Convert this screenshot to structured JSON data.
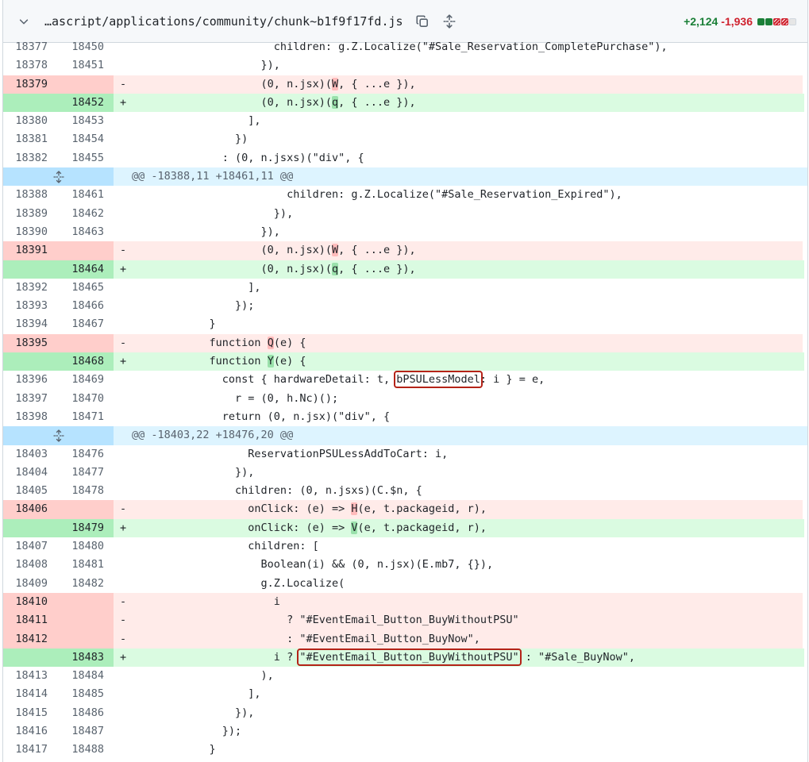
{
  "file": {
    "name": "…ascript/applications/community/chunk~b1f9f17fd.js",
    "additions": "+2,124",
    "deletions": "-1,936",
    "diffstat": [
      "g",
      "g",
      "r",
      "r",
      "n"
    ],
    "colors": {
      "add": "#1a7f37",
      "del": "#cf222e"
    }
  },
  "icons": {
    "collapse": "chevron-down-icon",
    "copy": "copy-icon",
    "expand_all": "unfold-icon",
    "expand_hunk": "unfold-icon"
  },
  "lines": [
    {
      "t": "ctx",
      "o": "18377",
      "n": "18450",
      "s": [
        {
          "x": "                      children: g.Z.Localize(\"#Sale_Reservation_CompletePurchase\"),"
        }
      ]
    },
    {
      "t": "ctx",
      "o": "18378",
      "n": "18451",
      "s": [
        {
          "x": "                    }),"
        }
      ]
    },
    {
      "t": "del",
      "o": "18379",
      "n": "",
      "s": [
        {
          "x": "                    (0, n.jsx)("
        },
        {
          "x": "W",
          "h": 1
        },
        {
          "x": ", { ...e }),"
        }
      ]
    },
    {
      "t": "add",
      "o": "",
      "n": "18452",
      "s": [
        {
          "x": "                    (0, n.jsx)("
        },
        {
          "x": "q",
          "h": 1
        },
        {
          "x": ", { ...e }),"
        }
      ]
    },
    {
      "t": "ctx",
      "o": "18380",
      "n": "18453",
      "s": [
        {
          "x": "                  ],"
        }
      ]
    },
    {
      "t": "ctx",
      "o": "18381",
      "n": "18454",
      "s": [
        {
          "x": "                })"
        }
      ]
    },
    {
      "t": "ctx",
      "o": "18382",
      "n": "18455",
      "s": [
        {
          "x": "              : (0, n.jsxs)(\"div\", {"
        }
      ]
    },
    {
      "t": "hunk",
      "s": [
        {
          "x": "@@ -18388,11 +18461,11 @@"
        }
      ]
    },
    {
      "t": "ctx",
      "o": "18388",
      "n": "18461",
      "s": [
        {
          "x": "                        children: g.Z.Localize(\"#Sale_Reservation_Expired\"),"
        }
      ]
    },
    {
      "t": "ctx",
      "o": "18389",
      "n": "18462",
      "s": [
        {
          "x": "                      }),"
        }
      ]
    },
    {
      "t": "ctx",
      "o": "18390",
      "n": "18463",
      "s": [
        {
          "x": "                    }),"
        }
      ]
    },
    {
      "t": "del",
      "o": "18391",
      "n": "",
      "s": [
        {
          "x": "                    (0, n.jsx)("
        },
        {
          "x": "W",
          "h": 1
        },
        {
          "x": ", { ...e }),"
        }
      ]
    },
    {
      "t": "add",
      "o": "",
      "n": "18464",
      "s": [
        {
          "x": "                    (0, n.jsx)("
        },
        {
          "x": "q",
          "h": 1
        },
        {
          "x": ", { ...e }),"
        }
      ]
    },
    {
      "t": "ctx",
      "o": "18392",
      "n": "18465",
      "s": [
        {
          "x": "                  ],"
        }
      ]
    },
    {
      "t": "ctx",
      "o": "18393",
      "n": "18466",
      "s": [
        {
          "x": "                });"
        }
      ]
    },
    {
      "t": "ctx",
      "o": "18394",
      "n": "18467",
      "s": [
        {
          "x": "            }"
        }
      ]
    },
    {
      "t": "del",
      "o": "18395",
      "n": "",
      "s": [
        {
          "x": "            function "
        },
        {
          "x": "Q",
          "h": 1
        },
        {
          "x": "(e) {"
        }
      ]
    },
    {
      "t": "add",
      "o": "",
      "n": "18468",
      "s": [
        {
          "x": "            function "
        },
        {
          "x": "Y",
          "h": 1
        },
        {
          "x": "(e) {"
        }
      ]
    },
    {
      "t": "ctx",
      "o": "18396",
      "n": "18469",
      "s": [
        {
          "x": "              const { hardwareDetail: t, "
        },
        {
          "x": "bPSULessModel",
          "b": 1
        },
        {
          "x": ": i } = e,"
        }
      ]
    },
    {
      "t": "ctx",
      "o": "18397",
      "n": "18470",
      "s": [
        {
          "x": "                r = (0, h.Nc)();"
        }
      ]
    },
    {
      "t": "ctx",
      "o": "18398",
      "n": "18471",
      "s": [
        {
          "x": "              return (0, n.jsx)(\"div\", {"
        }
      ]
    },
    {
      "t": "hunk",
      "s": [
        {
          "x": "@@ -18403,22 +18476,20 @@"
        }
      ]
    },
    {
      "t": "ctx",
      "o": "18403",
      "n": "18476",
      "s": [
        {
          "x": "                  ReservationPSULessAddToCart: i,"
        }
      ]
    },
    {
      "t": "ctx",
      "o": "18404",
      "n": "18477",
      "s": [
        {
          "x": "                }),"
        }
      ]
    },
    {
      "t": "ctx",
      "o": "18405",
      "n": "18478",
      "s": [
        {
          "x": "                children: (0, n.jsxs)(C.$n, {"
        }
      ]
    },
    {
      "t": "del",
      "o": "18406",
      "n": "",
      "s": [
        {
          "x": "                  onClick: (e) => "
        },
        {
          "x": "H",
          "h": 1
        },
        {
          "x": "(e, t.packageid, r),"
        }
      ]
    },
    {
      "t": "add",
      "o": "",
      "n": "18479",
      "s": [
        {
          "x": "                  onClick: (e) => "
        },
        {
          "x": "V",
          "h": 1
        },
        {
          "x": "(e, t.packageid, r),"
        }
      ]
    },
    {
      "t": "ctx",
      "o": "18407",
      "n": "18480",
      "s": [
        {
          "x": "                  children: ["
        }
      ]
    },
    {
      "t": "ctx",
      "o": "18408",
      "n": "18481",
      "s": [
        {
          "x": "                    Boolean(i) && (0, n.jsx)(E.mb7, {}),"
        }
      ]
    },
    {
      "t": "ctx",
      "o": "18409",
      "n": "18482",
      "s": [
        {
          "x": "                    g.Z.Localize("
        }
      ]
    },
    {
      "t": "del",
      "o": "18410",
      "n": "",
      "s": [
        {
          "x": "                      i"
        }
      ]
    },
    {
      "t": "del",
      "o": "18411",
      "n": "",
      "s": [
        {
          "x": "                        ? \"#EventEmail_Button_BuyWithoutPSU\""
        }
      ]
    },
    {
      "t": "del",
      "o": "18412",
      "n": "",
      "s": [
        {
          "x": "                        : \"#EventEmail_Button_BuyNow\","
        }
      ]
    },
    {
      "t": "add",
      "o": "",
      "n": "18483",
      "s": [
        {
          "x": "                      i ? "
        },
        {
          "x": "\"#EventEmail_Button_BuyWithoutPSU\"",
          "b": 1
        },
        {
          "x": " : \"#Sale_BuyNow\","
        }
      ]
    },
    {
      "t": "ctx",
      "o": "18413",
      "n": "18484",
      "s": [
        {
          "x": "                    ),"
        }
      ]
    },
    {
      "t": "ctx",
      "o": "18414",
      "n": "18485",
      "s": [
        {
          "x": "                  ],"
        }
      ]
    },
    {
      "t": "ctx",
      "o": "18415",
      "n": "18486",
      "s": [
        {
          "x": "                }),"
        }
      ]
    },
    {
      "t": "ctx",
      "o": "18416",
      "n": "18487",
      "s": [
        {
          "x": "              });"
        }
      ]
    },
    {
      "t": "ctx",
      "o": "18417",
      "n": "18488",
      "s": [
        {
          "x": "            }"
        }
      ]
    }
  ]
}
